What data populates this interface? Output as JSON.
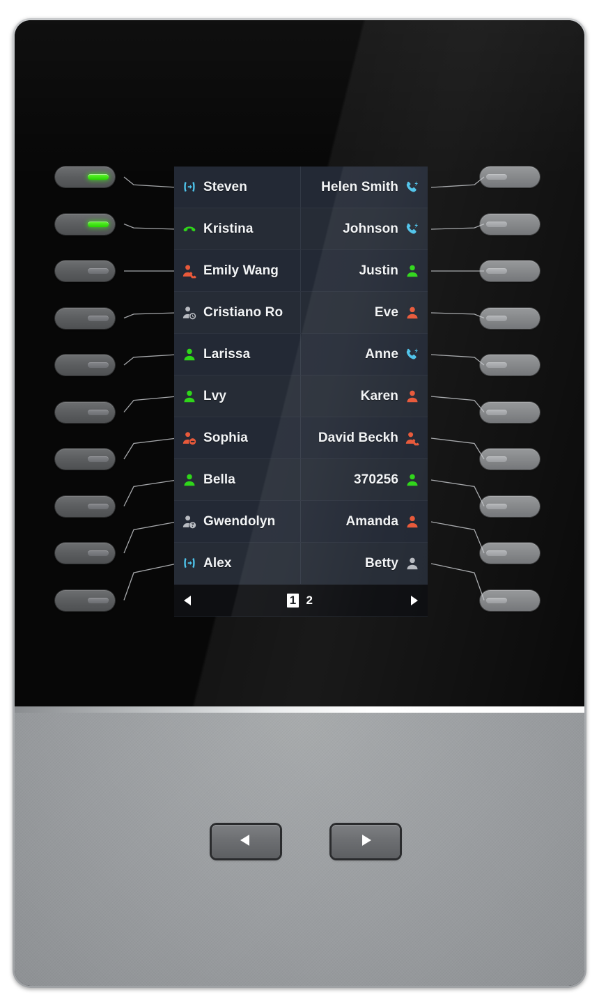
{
  "device": {
    "name": "IP Phone Expansion Module",
    "colors": {
      "led_on": "#35e000",
      "led_off": "#7d7f83",
      "screen_bg": "#242a34",
      "accent_green": "#2fd61a",
      "accent_blue": "#4ec3ea",
      "accent_red": "#e8593a",
      "accent_gray": "#b9bcc2",
      "text": "#f2f4f6",
      "body_gray": "#9a9da0"
    }
  },
  "screen": {
    "rows": [
      {
        "left": {
          "label": "Steven",
          "icon": "call-transfer-icon",
          "status": "transfer",
          "color": "#4ec3ea"
        },
        "right": {
          "label": "Helen Smith",
          "icon": "handset-ring-icon",
          "status": "ringing",
          "color": "#4ec3ea"
        }
      },
      {
        "left": {
          "label": "Kristina",
          "icon": "handset-offhook-icon",
          "status": "talking",
          "color": "#2fd61a"
        },
        "right": {
          "label": "Johnson",
          "icon": "handset-ring-icon",
          "status": "ringing",
          "color": "#4ec3ea"
        }
      },
      {
        "left": {
          "label": "Emily Wang",
          "icon": "user-busy-icon",
          "status": "busy",
          "color": "#e8593a"
        },
        "right": {
          "label": "Justin",
          "icon": "user-icon",
          "status": "idle",
          "color": "#2fd61a"
        }
      },
      {
        "left": {
          "label": "Cristiano Ro",
          "icon": "user-away-icon",
          "status": "away",
          "color": "#b9bcc2"
        },
        "right": {
          "label": "Eve",
          "icon": "user-icon",
          "status": "unavailable",
          "color": "#e8593a"
        }
      },
      {
        "left": {
          "label": "Larissa",
          "icon": "user-icon",
          "status": "idle",
          "color": "#2fd61a"
        },
        "right": {
          "label": "Anne",
          "icon": "handset-ring-icon",
          "status": "ringing",
          "color": "#4ec3ea"
        }
      },
      {
        "left": {
          "label": "Lvy",
          "icon": "user-icon",
          "status": "idle",
          "color": "#2fd61a"
        },
        "right": {
          "label": "Karen",
          "icon": "user-icon",
          "status": "unavailable",
          "color": "#e8593a"
        }
      },
      {
        "left": {
          "label": "Sophia",
          "icon": "user-dnd-icon",
          "status": "dnd",
          "color": "#e8593a"
        },
        "right": {
          "label": "David Beckh",
          "icon": "user-busy-icon",
          "status": "busy",
          "color": "#e8593a"
        }
      },
      {
        "left": {
          "label": "Bella",
          "icon": "user-icon",
          "status": "idle",
          "color": "#2fd61a"
        },
        "right": {
          "label": "370256",
          "icon": "user-icon",
          "status": "idle",
          "color": "#2fd61a"
        }
      },
      {
        "left": {
          "label": "Gwendolyn",
          "icon": "user-unknown-icon",
          "status": "unknown",
          "color": "#b9bcc2"
        },
        "right": {
          "label": "Amanda",
          "icon": "user-icon",
          "status": "unavailable",
          "color": "#e8593a"
        }
      },
      {
        "left": {
          "label": "Alex",
          "icon": "call-transfer-icon",
          "status": "transfer",
          "color": "#4ec3ea"
        },
        "right": {
          "label": "Betty",
          "icon": "user-icon",
          "status": "offline",
          "color": "#b9bcc2"
        }
      }
    ],
    "pager": {
      "prev_icon": "triangle-left-icon",
      "next_icon": "triangle-right-icon",
      "pages": [
        "1",
        "2"
      ],
      "active_page": "1"
    }
  },
  "left_keys": [
    {
      "label": "line-key-1",
      "led": "on"
    },
    {
      "label": "line-key-2",
      "led": "on"
    },
    {
      "label": "line-key-3",
      "led": "off"
    },
    {
      "label": "line-key-4",
      "led": "off"
    },
    {
      "label": "line-key-5",
      "led": "off"
    },
    {
      "label": "line-key-6",
      "led": "off"
    },
    {
      "label": "line-key-7",
      "led": "off"
    },
    {
      "label": "line-key-8",
      "led": "off"
    },
    {
      "label": "line-key-9",
      "led": "off"
    },
    {
      "label": "line-key-10",
      "led": "off"
    }
  ],
  "right_keys": [
    {
      "label": "line-key-11",
      "led": "off"
    },
    {
      "label": "line-key-12",
      "led": "off"
    },
    {
      "label": "line-key-13",
      "led": "off"
    },
    {
      "label": "line-key-14",
      "led": "off"
    },
    {
      "label": "line-key-15",
      "led": "off"
    },
    {
      "label": "line-key-16",
      "led": "off"
    },
    {
      "label": "line-key-17",
      "led": "off"
    },
    {
      "label": "line-key-18",
      "led": "off"
    },
    {
      "label": "line-key-19",
      "led": "off"
    },
    {
      "label": "line-key-20",
      "led": "off"
    }
  ],
  "nav": {
    "prev": {
      "label": "page-previous",
      "icon": "triangle-left-icon"
    },
    "next": {
      "label": "page-next",
      "icon": "triangle-right-icon"
    }
  }
}
